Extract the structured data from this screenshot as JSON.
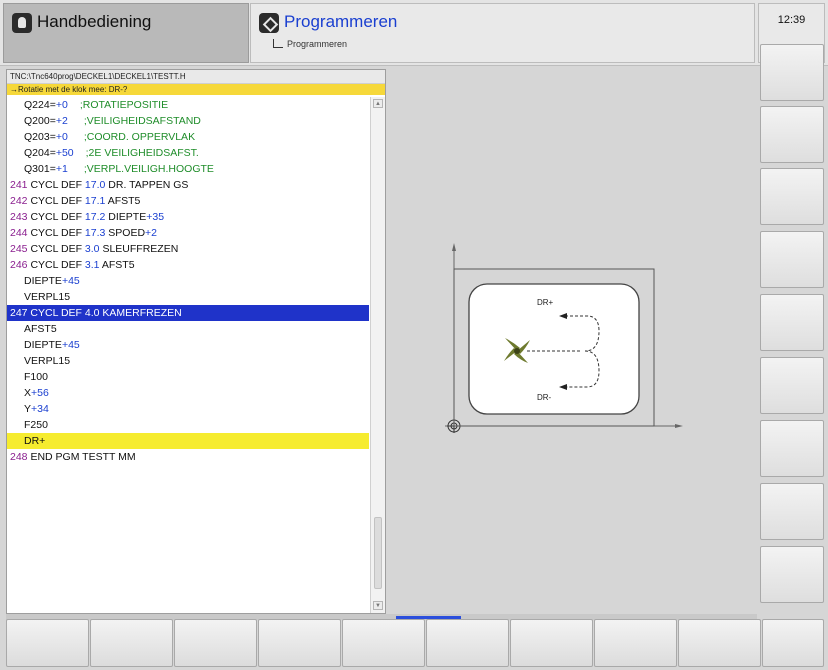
{
  "header": {
    "manual_mode_label": "Handbediening",
    "program_mode_label": "Programmeren",
    "program_submode_label": "Programmeren",
    "clock": "12:39"
  },
  "program": {
    "path": "TNC:\\Tnc640prog\\DECKEL1\\DECKEL1\\TESTT.H",
    "message": "→Rotatie met de klok mee: DR-?",
    "lines": [
      {
        "kind": "q",
        "name": "Q224",
        "val": "+0",
        "comment": ";ROTATIEPOSITIE"
      },
      {
        "kind": "q",
        "name": "Q200",
        "val": "+2",
        "comment": ";VEILIGHEIDSAFSTAND"
      },
      {
        "kind": "q",
        "name": "Q203",
        "val": "+0",
        "comment": ";COORD. OPPERVLAK"
      },
      {
        "kind": "q",
        "name": "Q204",
        "val": "+50",
        "comment": ";2E VEILIGHEIDSAFST."
      },
      {
        "kind": "q",
        "name": "Q301",
        "val": "+1",
        "comment": ";VERPL.VEILIGH.HOOGTE"
      },
      {
        "kind": "cyc",
        "num": "241",
        "text": "CYCL DEF",
        "val": "17.0",
        "rest": "DR. TAPPEN GS"
      },
      {
        "kind": "cyc",
        "num": "242",
        "text": "CYCL DEF",
        "val": "17.1",
        "rest": "AFST5"
      },
      {
        "kind": "cyc2",
        "num": "243",
        "text": "CYCL DEF",
        "val": "17.2",
        "rest": "DIEPTE",
        "rest_val": "+35"
      },
      {
        "kind": "cyc2",
        "num": "244",
        "text": "CYCL DEF",
        "val": "17.3",
        "rest": "SPOED",
        "rest_val": "+2"
      },
      {
        "kind": "cyc",
        "num": "245",
        "text": "CYCL DEF",
        "val": "3.0",
        "rest": "SLEUFFREZEN"
      },
      {
        "kind": "cyc",
        "num": "246",
        "text": "CYCL DEF",
        "val": "3.1",
        "rest": "AFST5"
      },
      {
        "kind": "par",
        "text": "DIEPTE",
        "val": "+45"
      },
      {
        "kind": "plain",
        "text": "VERPL15"
      },
      {
        "kind": "sel",
        "text": "247 CYCL DEF 4.0 KAMERFREZEN"
      },
      {
        "kind": "plain",
        "text": "AFST5"
      },
      {
        "kind": "par",
        "text": "DIEPTE",
        "val": "+45"
      },
      {
        "kind": "plain",
        "text": "VERPL15"
      },
      {
        "kind": "plain",
        "text": "F100"
      },
      {
        "kind": "par",
        "text": "X",
        "val": "+56"
      },
      {
        "kind": "par",
        "text": "Y",
        "val": "+34"
      },
      {
        "kind": "plain",
        "text": "F250"
      },
      {
        "kind": "hl",
        "text": "DR+"
      },
      {
        "kind": "end",
        "num": "248",
        "text": "END PGM TESTT MM"
      }
    ]
  },
  "graphic": {
    "dr_plus_label": "DR+",
    "dr_minus_label": "DR-"
  },
  "colors": {
    "selected_line": "#1f33c9",
    "highlight_line": "#f6ec2f",
    "message_bar": "#f6d83a",
    "line_number": "#8a1e8f",
    "value": "#1a3fd0",
    "comment": "#1f8d2a"
  }
}
